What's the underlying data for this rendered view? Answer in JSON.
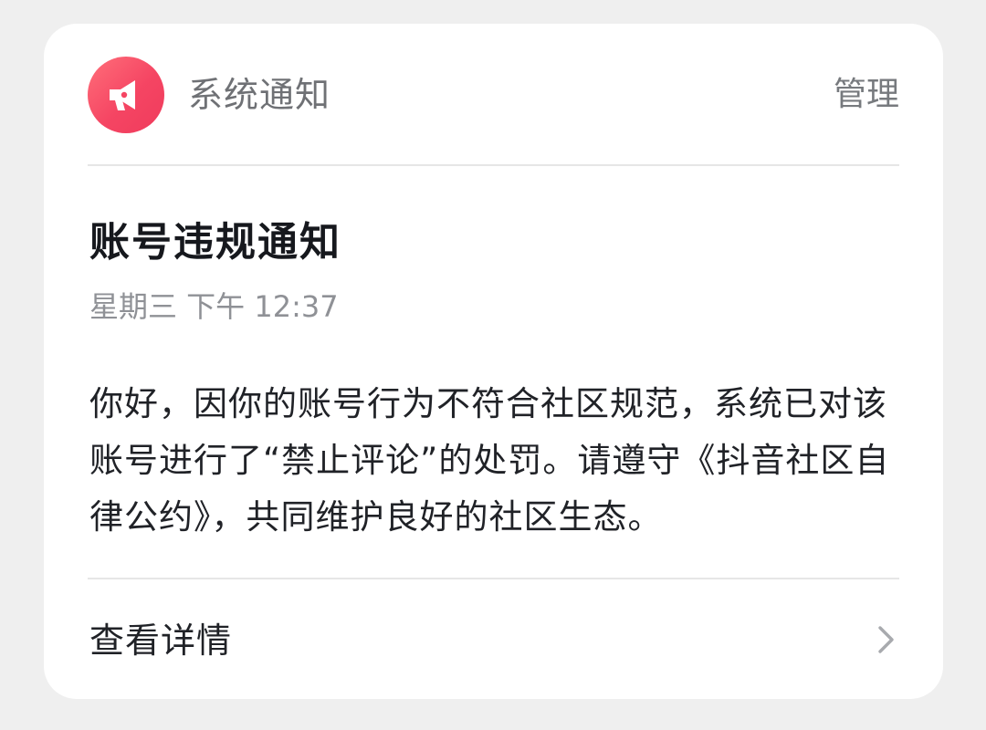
{
  "notification": {
    "sender": "系统通知",
    "manage_label": "管理",
    "title": "账号违规通知",
    "time": "星期三 下午 12:37",
    "body": "你好，因你的账号行为不符合社区规范，系统已对该账号进行了“禁止评论”的处罚。请遵守《抖音社区自律公约》，共同维护良好的社区生态。",
    "details_label": "查看详情"
  },
  "icons": {
    "app_icon": "megaphone-icon",
    "details_arrow": "chevron-right-icon"
  },
  "colors": {
    "accent": "#f54563",
    "background": "#efefef",
    "card": "#ffffff"
  }
}
